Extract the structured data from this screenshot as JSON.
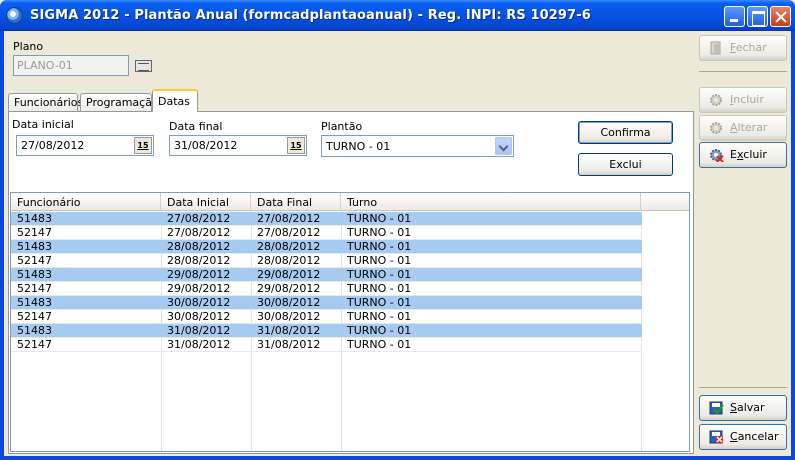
{
  "window": {
    "title": "SIGMA 2012 - Plantão Anual  (formcadplantaoanual)  - Reg. INPI: RS 10297-6"
  },
  "plano": {
    "label": "Plano",
    "value": "PLANO-01"
  },
  "tabs": [
    {
      "label": "Funcionários",
      "active": false
    },
    {
      "label": "Programação",
      "active": false
    },
    {
      "label": "Datas",
      "active": true
    }
  ],
  "form": {
    "data_inicial_label": "Data inicial",
    "data_inicial_value": "27/08/2012",
    "data_final_label": "Data final",
    "data_final_value": "31/08/2012",
    "plantao_label": "Plantão",
    "plantao_value": "TURNO - 01",
    "calendar_glyph": "15",
    "confirma_label": "Confirma",
    "exclui_label": "Exclui"
  },
  "grid": {
    "columns": [
      "Funcionário",
      "Data Inicial",
      "Data Final",
      "Turno"
    ],
    "rows": [
      {
        "funcionario": "51483",
        "data_inicial": "27/08/2012",
        "data_final": "27/08/2012",
        "turno": "TURNO - 01",
        "selected": true
      },
      {
        "funcionario": "52147",
        "data_inicial": "27/08/2012",
        "data_final": "27/08/2012",
        "turno": "TURNO - 01",
        "selected": false
      },
      {
        "funcionario": "51483",
        "data_inicial": "28/08/2012",
        "data_final": "28/08/2012",
        "turno": "TURNO - 01",
        "selected": true
      },
      {
        "funcionario": "52147",
        "data_inicial": "28/08/2012",
        "data_final": "28/08/2012",
        "turno": "TURNO - 01",
        "selected": false
      },
      {
        "funcionario": "51483",
        "data_inicial": "29/08/2012",
        "data_final": "29/08/2012",
        "turno": "TURNO - 01",
        "selected": true
      },
      {
        "funcionario": "52147",
        "data_inicial": "29/08/2012",
        "data_final": "29/08/2012",
        "turno": "TURNO - 01",
        "selected": false
      },
      {
        "funcionario": "51483",
        "data_inicial": "30/08/2012",
        "data_final": "30/08/2012",
        "turno": "TURNO - 01",
        "selected": true
      },
      {
        "funcionario": "52147",
        "data_inicial": "30/08/2012",
        "data_final": "30/08/2012",
        "turno": "TURNO - 01",
        "selected": false
      },
      {
        "funcionario": "51483",
        "data_inicial": "31/08/2012",
        "data_final": "31/08/2012",
        "turno": "TURNO - 01",
        "selected": true
      },
      {
        "funcionario": "52147",
        "data_inicial": "31/08/2012",
        "data_final": "31/08/2012",
        "turno": "TURNO - 01",
        "selected": false
      }
    ]
  },
  "toolbar": {
    "fechar": {
      "label": "Fechar",
      "hotkey": "F",
      "rest": "echar",
      "enabled": false,
      "icon": "door-icon"
    },
    "incluir": {
      "label": "Incluir",
      "hotkey": "I",
      "rest": "ncluir",
      "enabled": false,
      "icon": "gear-add-icon"
    },
    "alterar": {
      "label": "Alterar",
      "hotkey": "A",
      "rest": "lterar",
      "enabled": false,
      "icon": "gear-edit-icon"
    },
    "excluir": {
      "label": "Excluir",
      "hotkey": "x",
      "prefix": "E",
      "rest": "cluir",
      "enabled": true,
      "icon": "gear-delete-icon"
    },
    "salvar": {
      "label": "Salvar",
      "hotkey": "S",
      "rest": "alvar",
      "enabled": true,
      "icon": "save-check-icon"
    },
    "cancelar": {
      "label": "Cancelar",
      "hotkey": "C",
      "rest": "ancelar",
      "enabled": true,
      "icon": "cancel-x-icon"
    }
  },
  "colors": {
    "titlebar": "#0653E4",
    "selection": "#A6CAF0",
    "window_bg": "#ECE9D8"
  }
}
